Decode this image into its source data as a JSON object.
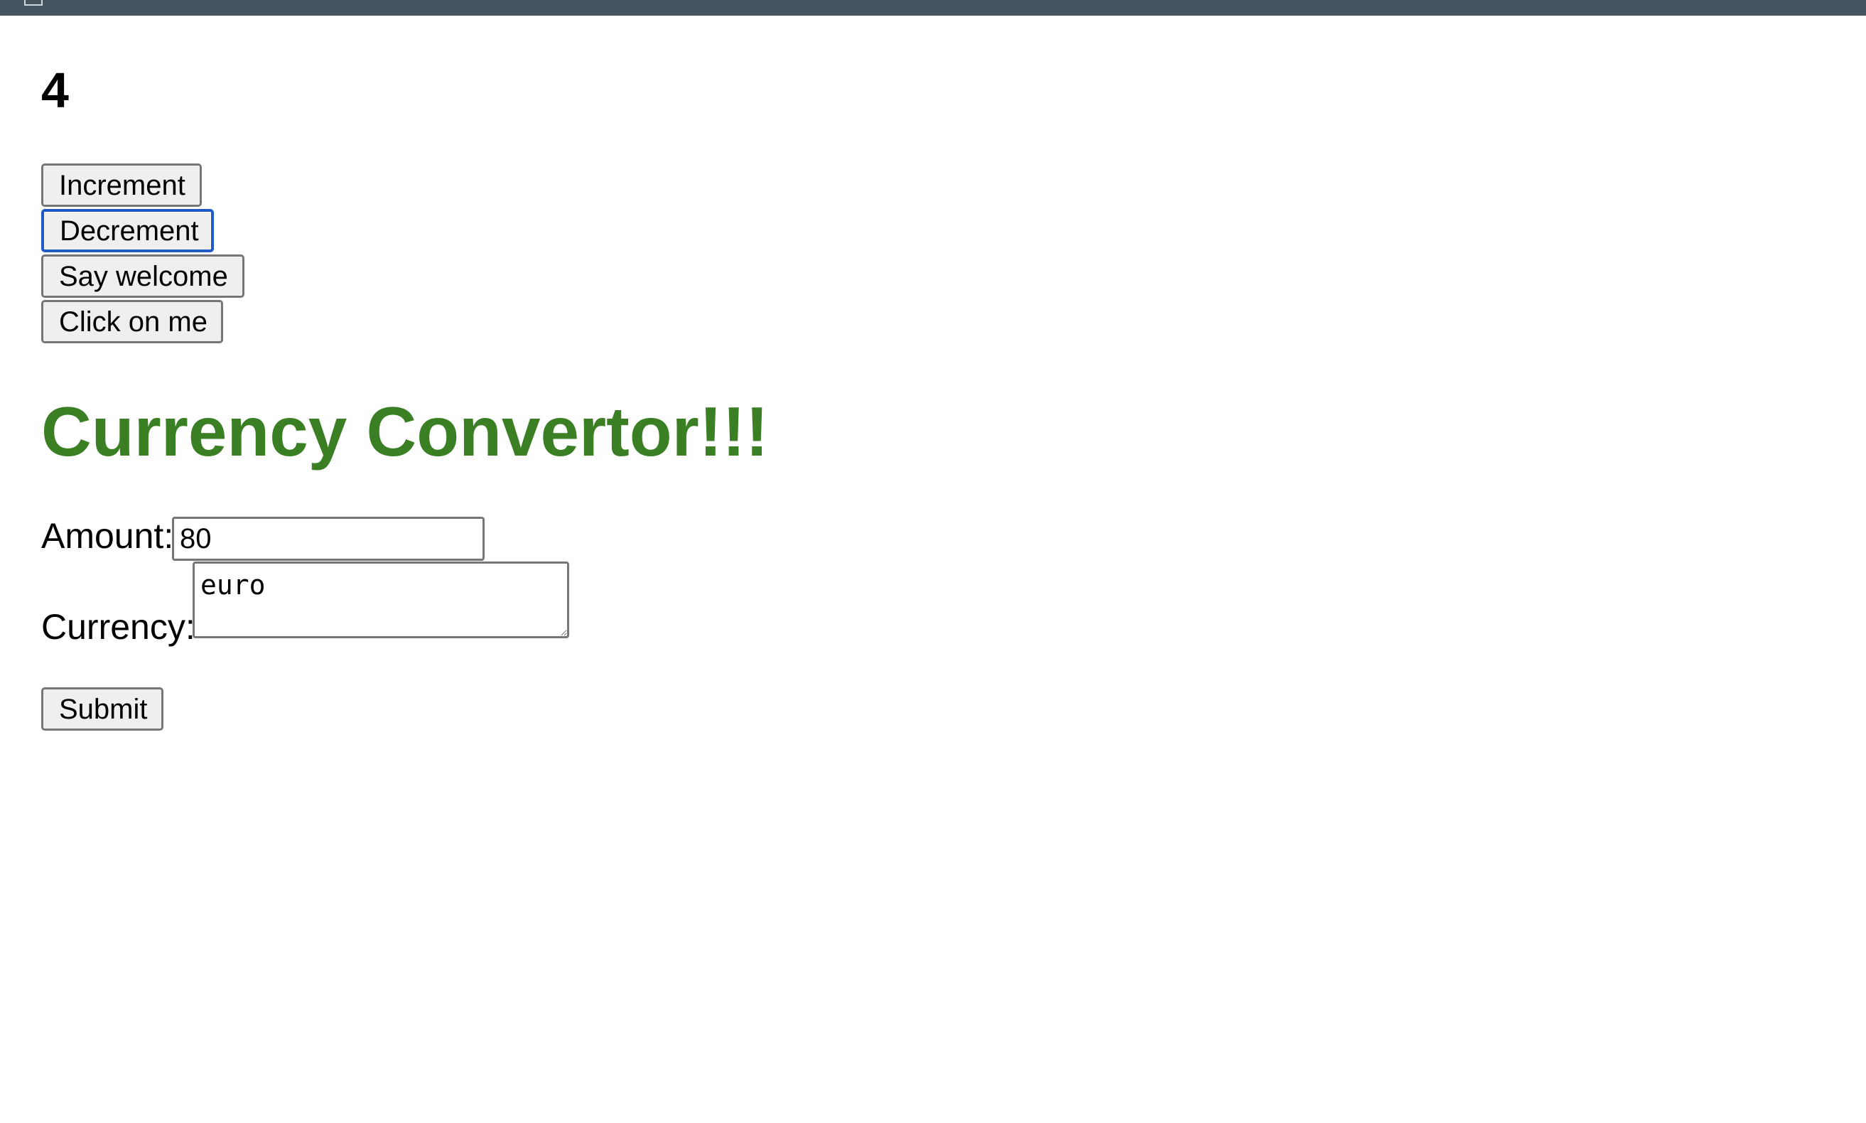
{
  "counter": {
    "value": "4"
  },
  "buttons": {
    "increment": "Increment",
    "decrement": "Decrement",
    "say_welcome": "Say welcome",
    "click_on_me": "Click on me"
  },
  "converter": {
    "title": "Currency Convertor!!!",
    "title_color": "#3a7f24",
    "amount_label": "Amount:",
    "amount_value": "80",
    "currency_label": "Currency:",
    "currency_value": "euro",
    "submit_label": "Submit"
  },
  "colors": {
    "topbar": "#46545f",
    "focus_ring": "#1f5ac8"
  }
}
